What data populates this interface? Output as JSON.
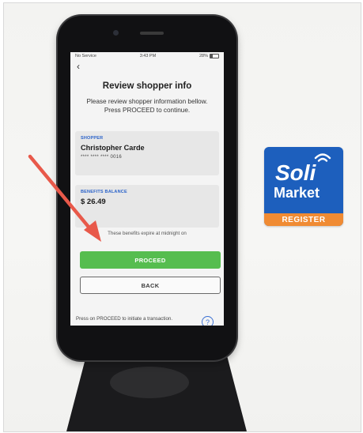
{
  "status_bar": {
    "carrier": "No Service",
    "time": "3:43 PM",
    "battery": "28%"
  },
  "screen": {
    "title": "Review shopper info",
    "instructions": "Please review shopper information bellow.  Press PROCEED to continue.",
    "shopper": {
      "label": "SHOPPER",
      "name": "Christopher  Carde",
      "card_number": "**** **** **** 0016"
    },
    "benefits": {
      "label": "BENEFITS BALANCE",
      "balance": "$ 26.49",
      "expire_note": "These benefits expire at midnight on"
    },
    "proceed_label": "PROCEED",
    "back_label": "BACK",
    "footer_note": "Press on PROCEED to initiate a transaction.",
    "help_symbol": "?"
  },
  "logo": {
    "line1": "Soli",
    "line2": "Market",
    "band": "REGISTER"
  },
  "colors": {
    "proceed_green": "#56bd4f",
    "label_blue": "#2a62c9",
    "logo_blue": "#1d5fbd",
    "logo_orange": "#f08b33",
    "arrow_red": "#e8594a"
  },
  "icons": {
    "back": "chevron-left-icon",
    "help": "question-circle-icon",
    "wifi": "wifi-icon",
    "battery": "battery-icon",
    "arrow": "red-arrow-annotation"
  }
}
